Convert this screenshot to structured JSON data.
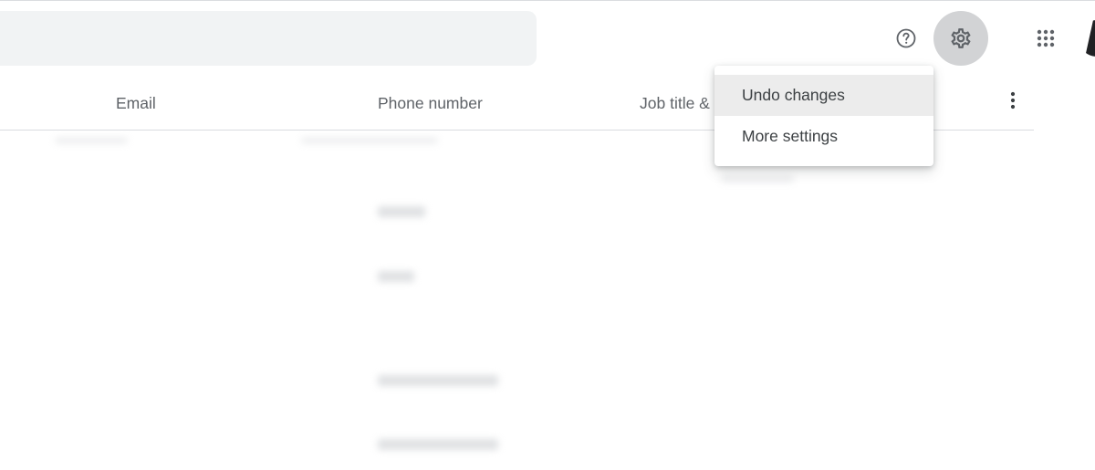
{
  "topbar": {
    "search_placeholder": "",
    "help_icon": "help-circle-icon",
    "settings_icon": "gear-icon",
    "apps_icon": "apps-grid-icon"
  },
  "table": {
    "columns": [
      "Email",
      "Phone number",
      "Job title & company"
    ],
    "more_icon": "more-vert-icon"
  },
  "settings_menu": {
    "items": [
      "Undo changes",
      "More settings"
    ]
  },
  "colors": {
    "search_bg": "#f1f3f4",
    "settings_active_bg": "#d2d3d5",
    "menu_hover_bg": "#ececec",
    "divider": "#dadce0"
  }
}
